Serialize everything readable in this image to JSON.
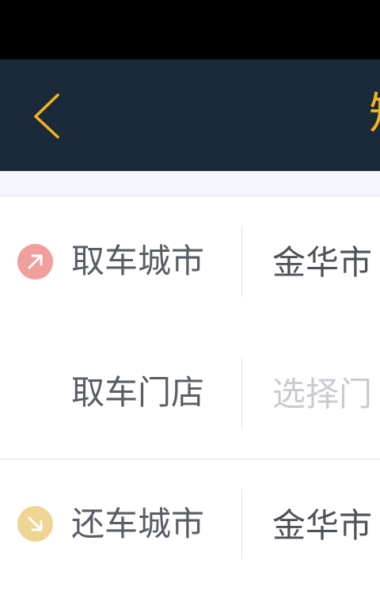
{
  "colors": {
    "nav_background": "#1b2a3b",
    "accent": "#f5b51a",
    "pickup_icon": "#f19f9c",
    "return_icon": "#eed594"
  },
  "nav": {
    "back_icon": "chevron-left-icon",
    "title": "短"
  },
  "form": {
    "pickup_city": {
      "icon": "arrow-up-right-icon",
      "label": "取车城市",
      "value": "金华市"
    },
    "pickup_store": {
      "label": "取车门店",
      "placeholder": "选择门"
    },
    "return_city": {
      "icon": "arrow-down-right-icon",
      "label": "还车城市",
      "value": "金华市"
    }
  }
}
